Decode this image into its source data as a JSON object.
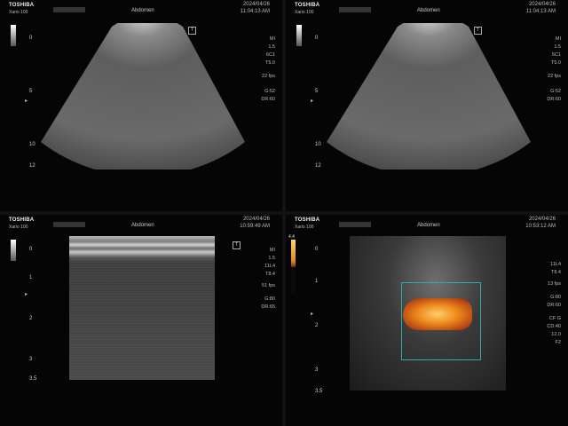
{
  "panels": [
    {
      "brand": "TOSHIBA",
      "model": "Xario 100",
      "exam": "Abdomen",
      "date": "2024/04/26",
      "time": "11:04:13 AM",
      "depth_labels": [
        "0",
        "5",
        "10",
        "12"
      ],
      "params": [
        "MI",
        "1.5",
        "6C1",
        "T5.0",
        "22 fps",
        "G:52",
        "DR:60"
      ]
    },
    {
      "brand": "TOSHIBA",
      "model": "Xario 100",
      "exam": "Abdomen",
      "date": "2024/04/26",
      "time": "11:04:13 AM",
      "depth_labels": [
        "0",
        "5",
        "10",
        "12"
      ],
      "params": [
        "MI",
        "1.5",
        "6C1",
        "T5.0",
        "22 fps",
        "G:52",
        "DR:60"
      ]
    },
    {
      "brand": "TOSHIBA",
      "model": "Xario 100",
      "exam": "Abdomen",
      "date": "2024/04/26",
      "time": "10:59:49 AM",
      "depth_labels": [
        "0",
        "1",
        "2",
        "3",
        "3.5"
      ],
      "params": [
        "MI",
        "1.5",
        "11L4",
        "T8.4",
        "51 fps",
        "G:80",
        "DR:65"
      ]
    },
    {
      "brand": "TOSHIBA",
      "model": "Xario 100",
      "exam": "Abdomen",
      "date": "2024/04/26",
      "time": "10:53:12 AM",
      "depth_labels": [
        "0",
        "1",
        "2",
        "3",
        "3.5"
      ],
      "params": [
        "11L4",
        "T8.4",
        "13 fps",
        "G:80",
        "DR:60",
        "CF G",
        "CD:40",
        "12.0",
        "F2"
      ],
      "color_scale_value": "4.4"
    }
  ],
  "icons": {
    "t_marker": "T",
    "focus_marker": "▸"
  }
}
